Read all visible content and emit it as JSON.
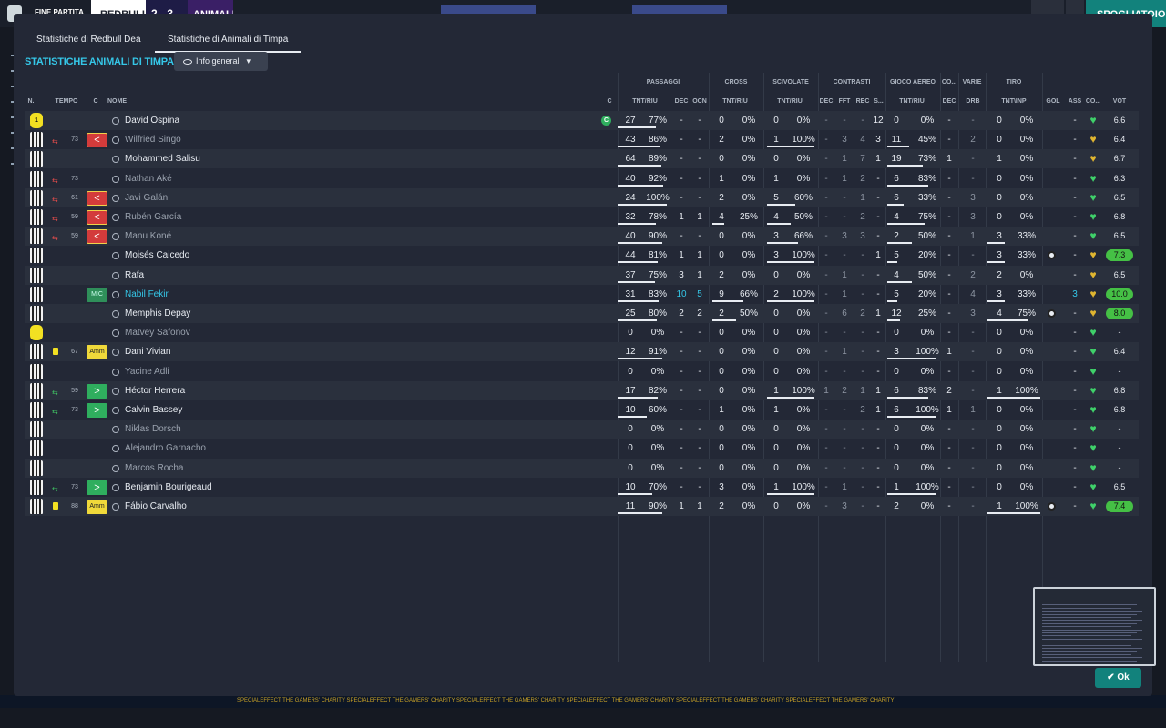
{
  "topbar": {
    "match_status": "FINE PARTITA",
    "home_team": "REDBULL",
    "score": "2 - 3",
    "away_team": "ANIMALI",
    "action_button": "SPOGLIATOIO"
  },
  "bottom_ticker": "SPECIALEFFECT THE GAMERS' CHARITY   SPECIALEFFECT THE GAMERS' CHARITY   SPECIALEFFECT THE GAMERS' CHARITY   SPECIALEFFECT THE GAMERS' CHARITY   SPECIALEFFECT THE GAMERS' CHARITY   SPECIALEFFECT THE GAMERS' CHARITY",
  "tabs": [
    {
      "label": "Statistiche di Redbull Dea",
      "active": false
    },
    {
      "label": "Statistiche di Animali di Timpa",
      "active": true
    }
  ],
  "section_title": "STATISTICHE ANIMALI DI TIMPA",
  "view_dropdown": {
    "label": "Info generali",
    "icon": "eye-icon"
  },
  "groups": {
    "passaggi": "PASSAGGI",
    "cross": "CROSS",
    "scivolate": "SCIVOLATE",
    "contrasti": "CONTRASTI",
    "gioco_aereo": "GIOCO AEREO",
    "co": "CO...",
    "varie": "VARIE",
    "tiro": "TIRO"
  },
  "columns": {
    "n": "N.",
    "tempo": "TEMPO",
    "c": "C",
    "nome": "NOME",
    "cap": "C",
    "pass": "TNT/RIU",
    "dec": "DEC",
    "ocn": "OCN",
    "cross": "TNT/RIU",
    "sciv": "TNT/RIU",
    "contr_dec": "DEC",
    "fft": "FFT",
    "rec": "REC",
    "s": "S...",
    "aereo": "TNT/RIU",
    "co_dec": "DEC",
    "drb": "DRB",
    "tiro": "TNT\\INP",
    "gol": "GOL",
    "ass": "ASS",
    "cond": "CO...",
    "vot": "VOT"
  },
  "accent_colors": {
    "cyan": "#35c7e8",
    "green": "#2fae5e",
    "red": "#d33b3b",
    "yellow": "#f0d93a",
    "teal": "#12827c"
  },
  "players": [
    {
      "kit": "gk",
      "kit_num": "1",
      "minute": "",
      "sub": "",
      "yellow": false,
      "badge": "",
      "name": "David Ospina",
      "name_style": "",
      "captain": true,
      "p_att": "27",
      "p_pct": "77%",
      "p_bar": 0.77,
      "dec": "-",
      "ocn": "-",
      "cr_att": "0",
      "cr_pct": "0%",
      "cr_bar": 0,
      "sc_att": "0",
      "sc_pct": "0%",
      "sc_bar": 0,
      "cdec": "-",
      "fft": "-",
      "rec": "-",
      "s": "12",
      "ae_att": "0",
      "ae_pct": "0%",
      "ae_bar": 0,
      "codec": "-",
      "drb": "-",
      "t_att": "0",
      "t_pct": "0%",
      "t_bar": 0,
      "gol": "",
      "ass": "-",
      "cond": "green",
      "vot": "6.6",
      "vot_hi": false
    },
    {
      "kit": "out",
      "kit_num": "",
      "minute": "73",
      "sub": "off",
      "yellow": false,
      "badge": "out",
      "name": "Wilfried Singo",
      "name_style": "dim",
      "captain": false,
      "p_att": "43",
      "p_pct": "86%",
      "p_bar": 0.86,
      "dec": "-",
      "ocn": "-",
      "cr_att": "2",
      "cr_pct": "0%",
      "cr_bar": 0,
      "sc_att": "1",
      "sc_pct": "100%",
      "sc_bar": 1,
      "cdec": "-",
      "fft": "3",
      "rec": "4",
      "s": "3",
      "ae_att": "11",
      "ae_pct": "45%",
      "ae_bar": 0.45,
      "codec": "-",
      "drb": "2",
      "t_att": "0",
      "t_pct": "0%",
      "t_bar": 0,
      "gol": "",
      "ass": "-",
      "cond": "yellow",
      "vot": "6.4",
      "vot_hi": false
    },
    {
      "kit": "out",
      "kit_num": "",
      "minute": "",
      "sub": "",
      "yellow": false,
      "badge": "",
      "name": "Mohammed Salisu",
      "name_style": "",
      "captain": false,
      "p_att": "64",
      "p_pct": "89%",
      "p_bar": 0.89,
      "dec": "-",
      "ocn": "-",
      "cr_att": "0",
      "cr_pct": "0%",
      "cr_bar": 0,
      "sc_att": "0",
      "sc_pct": "0%",
      "sc_bar": 0,
      "cdec": "-",
      "fft": "1",
      "rec": "7",
      "s": "1",
      "ae_att": "19",
      "ae_pct": "73%",
      "ae_bar": 0.73,
      "codec": "1",
      "drb": "-",
      "t_att": "1",
      "t_pct": "0%",
      "t_bar": 0,
      "gol": "",
      "ass": "-",
      "cond": "yellow",
      "vot": "6.7",
      "vot_hi": false
    },
    {
      "kit": "out",
      "kit_num": "",
      "minute": "73",
      "sub": "off",
      "yellow": false,
      "badge": "",
      "name": "Nathan Aké",
      "name_style": "dim",
      "captain": false,
      "p_att": "40",
      "p_pct": "92%",
      "p_bar": 0.92,
      "dec": "-",
      "ocn": "-",
      "cr_att": "1",
      "cr_pct": "0%",
      "cr_bar": 0,
      "sc_att": "1",
      "sc_pct": "0%",
      "sc_bar": 0,
      "cdec": "-",
      "fft": "1",
      "rec": "2",
      "s": "-",
      "ae_att": "6",
      "ae_pct": "83%",
      "ae_bar": 0.83,
      "codec": "-",
      "drb": "-",
      "t_att": "0",
      "t_pct": "0%",
      "t_bar": 0,
      "gol": "",
      "ass": "-",
      "cond": "green",
      "vot": "6.3",
      "vot_hi": false
    },
    {
      "kit": "out",
      "kit_num": "",
      "minute": "61",
      "sub": "off",
      "yellow": false,
      "badge": "out",
      "name": "Javi Galán",
      "name_style": "dim",
      "captain": false,
      "p_att": "24",
      "p_pct": "100%",
      "p_bar": 1,
      "dec": "-",
      "ocn": "-",
      "cr_att": "2",
      "cr_pct": "0%",
      "cr_bar": 0,
      "sc_att": "5",
      "sc_pct": "60%",
      "sc_bar": 0.6,
      "cdec": "-",
      "fft": "-",
      "rec": "1",
      "s": "-",
      "ae_att": "6",
      "ae_pct": "33%",
      "ae_bar": 0.33,
      "codec": "-",
      "drb": "3",
      "t_att": "0",
      "t_pct": "0%",
      "t_bar": 0,
      "gol": "",
      "ass": "-",
      "cond": "green",
      "vot": "6.5",
      "vot_hi": false
    },
    {
      "kit": "out",
      "kit_num": "",
      "minute": "59",
      "sub": "off",
      "yellow": false,
      "badge": "out",
      "name": "Rubén García",
      "name_style": "dim",
      "captain": false,
      "p_att": "32",
      "p_pct": "78%",
      "p_bar": 0.78,
      "dec": "1",
      "ocn": "1",
      "cr_att": "4",
      "cr_pct": "25%",
      "cr_bar": 0.25,
      "sc_att": "4",
      "sc_pct": "50%",
      "sc_bar": 0.5,
      "cdec": "-",
      "fft": "-",
      "rec": "2",
      "s": "-",
      "ae_att": "4",
      "ae_pct": "75%",
      "ae_bar": 0.75,
      "codec": "-",
      "drb": "3",
      "t_att": "0",
      "t_pct": "0%",
      "t_bar": 0,
      "gol": "",
      "ass": "-",
      "cond": "green",
      "vot": "6.8",
      "vot_hi": false
    },
    {
      "kit": "out",
      "kit_num": "",
      "minute": "59",
      "sub": "off",
      "yellow": false,
      "badge": "out",
      "name": "Manu Koné",
      "name_style": "dim",
      "captain": false,
      "p_att": "40",
      "p_pct": "90%",
      "p_bar": 0.9,
      "dec": "-",
      "ocn": "-",
      "cr_att": "0",
      "cr_pct": "0%",
      "cr_bar": 0,
      "sc_att": "3",
      "sc_pct": "66%",
      "sc_bar": 0.66,
      "cdec": "-",
      "fft": "3",
      "rec": "3",
      "s": "-",
      "ae_att": "2",
      "ae_pct": "50%",
      "ae_bar": 0.5,
      "codec": "-",
      "drb": "1",
      "t_att": "3",
      "t_pct": "33%",
      "t_bar": 0.33,
      "gol": "",
      "ass": "-",
      "cond": "green",
      "vot": "6.5",
      "vot_hi": false
    },
    {
      "kit": "out",
      "kit_num": "",
      "minute": "",
      "sub": "",
      "yellow": false,
      "badge": "",
      "name": "Moisés Caicedo",
      "name_style": "",
      "captain": false,
      "p_att": "44",
      "p_pct": "81%",
      "p_bar": 0.81,
      "dec": "1",
      "ocn": "1",
      "cr_att": "0",
      "cr_pct": "0%",
      "cr_bar": 0,
      "sc_att": "3",
      "sc_pct": "100%",
      "sc_bar": 1,
      "cdec": "-",
      "fft": "-",
      "rec": "-",
      "s": "1",
      "ae_att": "5",
      "ae_pct": "20%",
      "ae_bar": 0.2,
      "codec": "-",
      "drb": "-",
      "t_att": "3",
      "t_pct": "33%",
      "t_bar": 0.33,
      "gol": "ball",
      "ass": "-",
      "cond": "yellow",
      "vot": "7.3",
      "vot_hi": true
    },
    {
      "kit": "out",
      "kit_num": "",
      "minute": "",
      "sub": "",
      "yellow": false,
      "badge": "",
      "name": "Rafa",
      "name_style": "",
      "captain": false,
      "p_att": "37",
      "p_pct": "75%",
      "p_bar": 0.75,
      "dec": "3",
      "ocn": "1",
      "cr_att": "2",
      "cr_pct": "0%",
      "cr_bar": 0,
      "sc_att": "0",
      "sc_pct": "0%",
      "sc_bar": 0,
      "cdec": "-",
      "fft": "1",
      "rec": "-",
      "s": "-",
      "ae_att": "4",
      "ae_pct": "50%",
      "ae_bar": 0.5,
      "codec": "-",
      "drb": "2",
      "t_att": "2",
      "t_pct": "0%",
      "t_bar": 0,
      "gol": "",
      "ass": "-",
      "cond": "yellow",
      "vot": "6.5",
      "vot_hi": false
    },
    {
      "kit": "out",
      "kit_num": "",
      "minute": "",
      "sub": "",
      "yellow": false,
      "badge": "mic",
      "name": "Nabil Fekir",
      "name_style": "blue",
      "captain": false,
      "p_att": "31",
      "p_pct": "83%",
      "p_bar": 0.83,
      "dec": "10",
      "ocn": "5",
      "cr_att": "9",
      "cr_pct": "66%",
      "cr_bar": 0.66,
      "sc_att": "2",
      "sc_pct": "100%",
      "sc_bar": 1,
      "cdec": "-",
      "fft": "1",
      "rec": "-",
      "s": "-",
      "ae_att": "5",
      "ae_pct": "20%",
      "ae_bar": 0.2,
      "codec": "-",
      "drb": "4",
      "t_att": "3",
      "t_pct": "33%",
      "t_bar": 0.33,
      "gol": "",
      "ass": "3",
      "cond": "yellow",
      "vot": "10.0",
      "vot_hi": true,
      "blue": true
    },
    {
      "kit": "out",
      "kit_num": "",
      "minute": "",
      "sub": "",
      "yellow": false,
      "badge": "",
      "name": "Memphis Depay",
      "name_style": "",
      "captain": false,
      "p_att": "25",
      "p_pct": "80%",
      "p_bar": 0.8,
      "dec": "2",
      "ocn": "2",
      "cr_att": "2",
      "cr_pct": "50%",
      "cr_bar": 0.5,
      "sc_att": "0",
      "sc_pct": "0%",
      "sc_bar": 0,
      "cdec": "-",
      "fft": "6",
      "rec": "2",
      "s": "1",
      "ae_att": "12",
      "ae_pct": "25%",
      "ae_bar": 0.25,
      "codec": "-",
      "drb": "3",
      "t_att": "4",
      "t_pct": "75%",
      "t_bar": 0.75,
      "gol": "ball",
      "ass": "-",
      "cond": "yellow",
      "vot": "8.0",
      "vot_hi": true
    },
    {
      "kit": "gk",
      "kit_num": "",
      "minute": "",
      "sub": "",
      "yellow": false,
      "badge": "",
      "name": "Matvey Safonov",
      "name_style": "dim",
      "captain": false,
      "p_att": "0",
      "p_pct": "0%",
      "p_bar": 0,
      "dec": "-",
      "ocn": "-",
      "cr_att": "0",
      "cr_pct": "0%",
      "cr_bar": 0,
      "sc_att": "0",
      "sc_pct": "0%",
      "sc_bar": 0,
      "cdec": "-",
      "fft": "-",
      "rec": "-",
      "s": "-",
      "ae_att": "0",
      "ae_pct": "0%",
      "ae_bar": 0,
      "codec": "-",
      "drb": "-",
      "t_att": "0",
      "t_pct": "0%",
      "t_bar": 0,
      "gol": "",
      "ass": "-",
      "cond": "green",
      "vot": "-",
      "vot_hi": false
    },
    {
      "kit": "out",
      "kit_num": "",
      "minute": "67",
      "sub": "",
      "yellow": true,
      "badge": "amm",
      "name": "Dani Vivian",
      "name_style": "",
      "captain": false,
      "p_att": "12",
      "p_pct": "91%",
      "p_bar": 0.91,
      "dec": "-",
      "ocn": "-",
      "cr_att": "0",
      "cr_pct": "0%",
      "cr_bar": 0,
      "sc_att": "0",
      "sc_pct": "0%",
      "sc_bar": 0,
      "cdec": "-",
      "fft": "1",
      "rec": "-",
      "s": "-",
      "ae_att": "3",
      "ae_pct": "100%",
      "ae_bar": 1,
      "codec": "1",
      "drb": "-",
      "t_att": "0",
      "t_pct": "0%",
      "t_bar": 0,
      "gol": "",
      "ass": "-",
      "cond": "green",
      "vot": "6.4",
      "vot_hi": false
    },
    {
      "kit": "out",
      "kit_num": "",
      "minute": "",
      "sub": "",
      "yellow": false,
      "badge": "",
      "name": "Yacine Adli",
      "name_style": "dim",
      "captain": false,
      "p_att": "0",
      "p_pct": "0%",
      "p_bar": 0,
      "dec": "-",
      "ocn": "-",
      "cr_att": "0",
      "cr_pct": "0%",
      "cr_bar": 0,
      "sc_att": "0",
      "sc_pct": "0%",
      "sc_bar": 0,
      "cdec": "-",
      "fft": "-",
      "rec": "-",
      "s": "-",
      "ae_att": "0",
      "ae_pct": "0%",
      "ae_bar": 0,
      "codec": "-",
      "drb": "-",
      "t_att": "0",
      "t_pct": "0%",
      "t_bar": 0,
      "gol": "",
      "ass": "-",
      "cond": "green",
      "vot": "-",
      "vot_hi": false
    },
    {
      "kit": "out",
      "kit_num": "",
      "minute": "59",
      "sub": "on",
      "yellow": false,
      "badge": "in",
      "name": "Héctor Herrera",
      "name_style": "",
      "captain": false,
      "p_att": "17",
      "p_pct": "82%",
      "p_bar": 0.82,
      "dec": "-",
      "ocn": "-",
      "cr_att": "0",
      "cr_pct": "0%",
      "cr_bar": 0,
      "sc_att": "1",
      "sc_pct": "100%",
      "sc_bar": 1,
      "cdec": "1",
      "fft": "2",
      "rec": "1",
      "s": "1",
      "ae_att": "6",
      "ae_pct": "83%",
      "ae_bar": 0.83,
      "codec": "2",
      "drb": "-",
      "t_att": "1",
      "t_pct": "100%",
      "t_bar": 1,
      "gol": "",
      "ass": "-",
      "cond": "green",
      "vot": "6.8",
      "vot_hi": false
    },
    {
      "kit": "out",
      "kit_num": "",
      "minute": "73",
      "sub": "on",
      "yellow": false,
      "badge": "in",
      "name": "Calvin Bassey",
      "name_style": "",
      "captain": false,
      "p_att": "10",
      "p_pct": "60%",
      "p_bar": 0.6,
      "dec": "-",
      "ocn": "-",
      "cr_att": "1",
      "cr_pct": "0%",
      "cr_bar": 0,
      "sc_att": "1",
      "sc_pct": "0%",
      "sc_bar": 0,
      "cdec": "-",
      "fft": "-",
      "rec": "2",
      "s": "1",
      "ae_att": "6",
      "ae_pct": "100%",
      "ae_bar": 1,
      "codec": "1",
      "drb": "1",
      "t_att": "0",
      "t_pct": "0%",
      "t_bar": 0,
      "gol": "",
      "ass": "-",
      "cond": "green",
      "vot": "6.8",
      "vot_hi": false
    },
    {
      "kit": "out",
      "kit_num": "",
      "minute": "",
      "sub": "",
      "yellow": false,
      "badge": "",
      "name": "Niklas Dorsch",
      "name_style": "dim",
      "captain": false,
      "p_att": "0",
      "p_pct": "0%",
      "p_bar": 0,
      "dec": "-",
      "ocn": "-",
      "cr_att": "0",
      "cr_pct": "0%",
      "cr_bar": 0,
      "sc_att": "0",
      "sc_pct": "0%",
      "sc_bar": 0,
      "cdec": "-",
      "fft": "-",
      "rec": "-",
      "s": "-",
      "ae_att": "0",
      "ae_pct": "0%",
      "ae_bar": 0,
      "codec": "-",
      "drb": "-",
      "t_att": "0",
      "t_pct": "0%",
      "t_bar": 0,
      "gol": "",
      "ass": "-",
      "cond": "green",
      "vot": "-",
      "vot_hi": false
    },
    {
      "kit": "out",
      "kit_num": "",
      "minute": "",
      "sub": "",
      "yellow": false,
      "badge": "",
      "name": "Alejandro Garnacho",
      "name_style": "dim",
      "captain": false,
      "p_att": "0",
      "p_pct": "0%",
      "p_bar": 0,
      "dec": "-",
      "ocn": "-",
      "cr_att": "0",
      "cr_pct": "0%",
      "cr_bar": 0,
      "sc_att": "0",
      "sc_pct": "0%",
      "sc_bar": 0,
      "cdec": "-",
      "fft": "-",
      "rec": "-",
      "s": "-",
      "ae_att": "0",
      "ae_pct": "0%",
      "ae_bar": 0,
      "codec": "-",
      "drb": "-",
      "t_att": "0",
      "t_pct": "0%",
      "t_bar": 0,
      "gol": "",
      "ass": "-",
      "cond": "green",
      "vot": "-",
      "vot_hi": false
    },
    {
      "kit": "out",
      "kit_num": "",
      "minute": "",
      "sub": "",
      "yellow": false,
      "badge": "",
      "name": "Marcos Rocha",
      "name_style": "dim",
      "captain": false,
      "p_att": "0",
      "p_pct": "0%",
      "p_bar": 0,
      "dec": "-",
      "ocn": "-",
      "cr_att": "0",
      "cr_pct": "0%",
      "cr_bar": 0,
      "sc_att": "0",
      "sc_pct": "0%",
      "sc_bar": 0,
      "cdec": "-",
      "fft": "-",
      "rec": "-",
      "s": "-",
      "ae_att": "0",
      "ae_pct": "0%",
      "ae_bar": 0,
      "codec": "-",
      "drb": "-",
      "t_att": "0",
      "t_pct": "0%",
      "t_bar": 0,
      "gol": "",
      "ass": "-",
      "cond": "green",
      "vot": "-",
      "vot_hi": false
    },
    {
      "kit": "out",
      "kit_num": "",
      "minute": "73",
      "sub": "on",
      "yellow": false,
      "badge": "in",
      "name": "Benjamin Bourigeaud",
      "name_style": "",
      "captain": false,
      "p_att": "10",
      "p_pct": "70%",
      "p_bar": 0.7,
      "dec": "-",
      "ocn": "-",
      "cr_att": "3",
      "cr_pct": "0%",
      "cr_bar": 0,
      "sc_att": "1",
      "sc_pct": "100%",
      "sc_bar": 1,
      "cdec": "-",
      "fft": "1",
      "rec": "-",
      "s": "-",
      "ae_att": "1",
      "ae_pct": "100%",
      "ae_bar": 1,
      "codec": "-",
      "drb": "-",
      "t_att": "0",
      "t_pct": "0%",
      "t_bar": 0,
      "gol": "",
      "ass": "-",
      "cond": "green",
      "vot": "6.5",
      "vot_hi": false
    },
    {
      "kit": "out",
      "kit_num": "",
      "minute": "88",
      "sub": "",
      "yellow": true,
      "badge": "amm",
      "name": "Fábio Carvalho",
      "name_style": "",
      "captain": false,
      "p_att": "11",
      "p_pct": "90%",
      "p_bar": 0.9,
      "dec": "1",
      "ocn": "1",
      "cr_att": "2",
      "cr_pct": "0%",
      "cr_bar": 0,
      "sc_att": "0",
      "sc_pct": "0%",
      "sc_bar": 0,
      "cdec": "-",
      "fft": "3",
      "rec": "-",
      "s": "-",
      "ae_att": "2",
      "ae_pct": "0%",
      "ae_bar": 0,
      "codec": "-",
      "drb": "-",
      "t_att": "1",
      "t_pct": "100%",
      "t_bar": 1,
      "gol": "ball",
      "ass": "-",
      "cond": "green",
      "vot": "7.4",
      "vot_hi": true
    }
  ],
  "badges": {
    "amm": "Amm",
    "mic": "MIC",
    "out": "<",
    "in": ">"
  },
  "captain_letter": "C",
  "ok_button": "Ok"
}
